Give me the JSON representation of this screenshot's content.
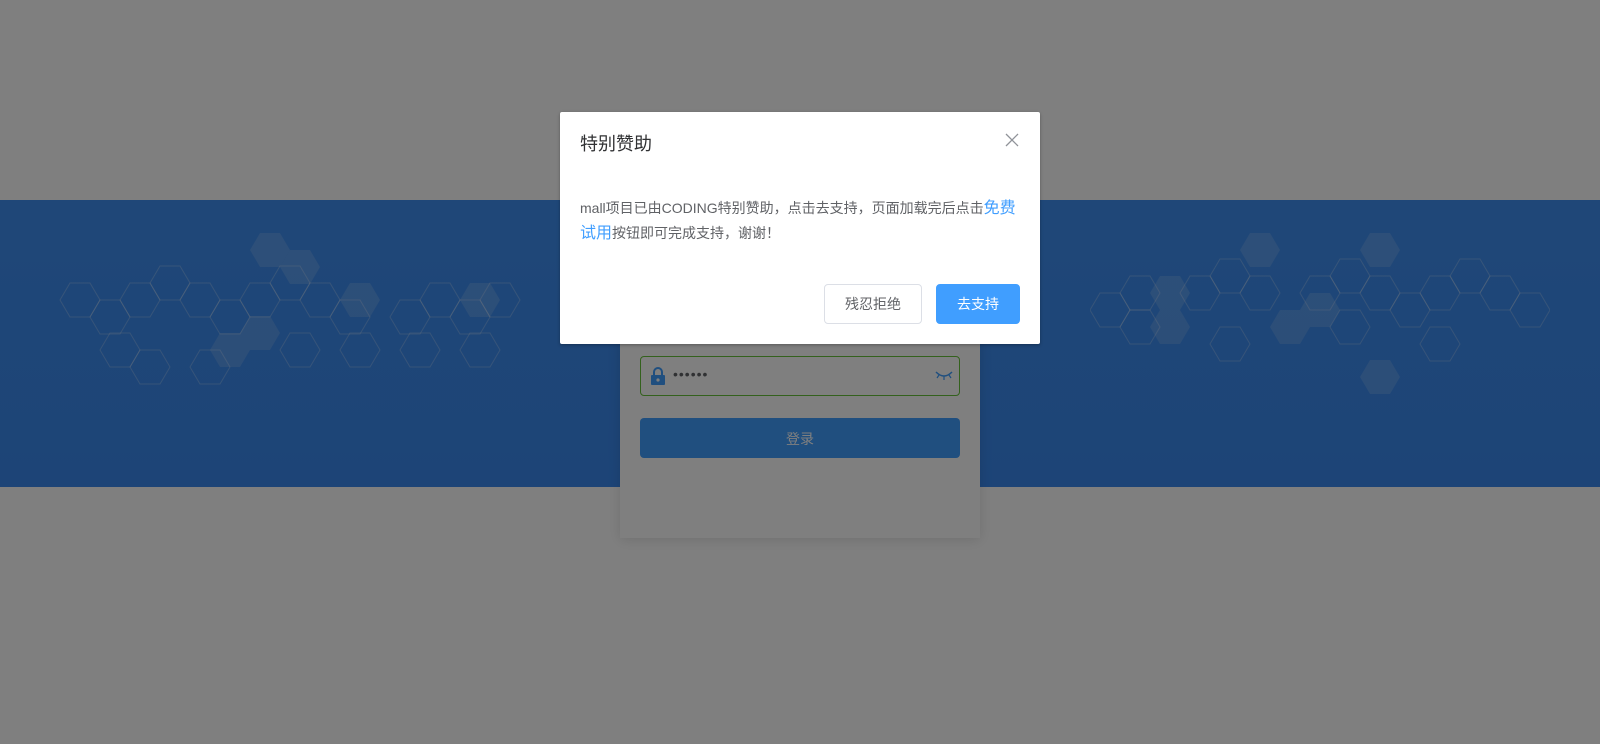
{
  "background": {
    "band_color": "#3f8ff0"
  },
  "login": {
    "password_value": "••••••",
    "login_label": "登录",
    "accent": "#409eff",
    "field_border": "#67c23a"
  },
  "dialog": {
    "title": "特别赞助",
    "message_part1": "mall项目已由CODING特别赞助，点击去支持，页面加载完后点击",
    "link_text": "免费试用",
    "message_part2": "按钮即可完成支持，谢谢！",
    "cancel_label": "残忍拒绝",
    "confirm_label": "去支持",
    "close_icon": "close-icon"
  }
}
